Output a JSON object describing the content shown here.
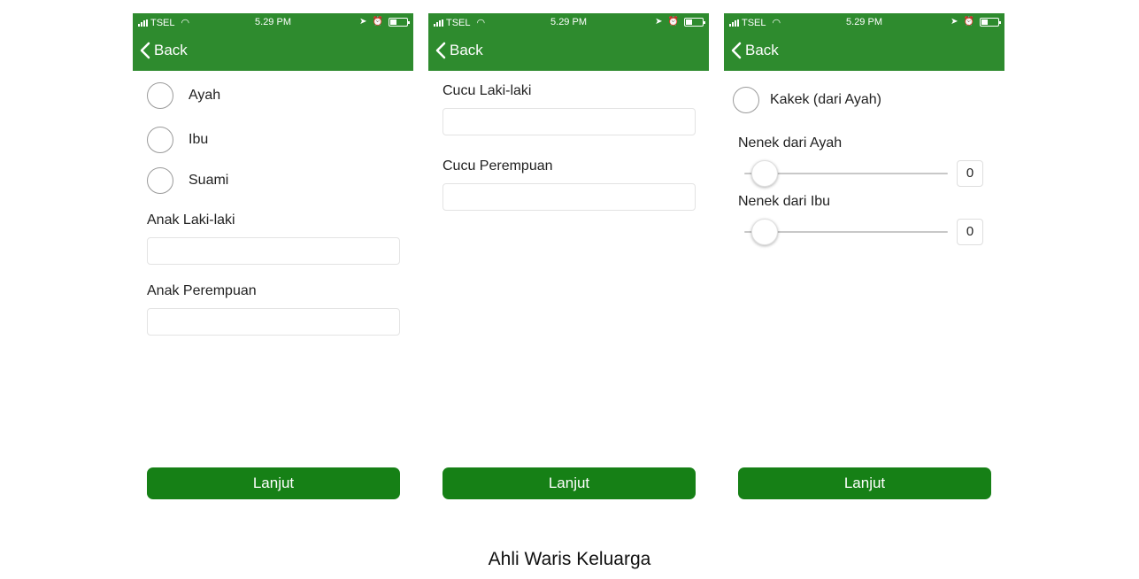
{
  "statusbar": {
    "carrier": "TSEL",
    "time": "5.29 PM",
    "theme_color": "#2e8b2e"
  },
  "navbar": {
    "back_label": "Back"
  },
  "screen1": {
    "radios": [
      {
        "label": "Ayah",
        "selected": false
      },
      {
        "label": "Ibu",
        "selected": false
      },
      {
        "label": "Suami",
        "selected": false
      }
    ],
    "fields": [
      {
        "label": "Anak Laki-laki",
        "value": ""
      },
      {
        "label": "Anak Perempuan",
        "value": ""
      }
    ],
    "button_label": "Lanjut"
  },
  "screen2": {
    "fields": [
      {
        "label": "Cucu Laki-laki",
        "value": ""
      },
      {
        "label": "Cucu Perempuan",
        "value": ""
      }
    ],
    "button_label": "Lanjut"
  },
  "screen3": {
    "radios": [
      {
        "label": "Kakek (dari Ayah)",
        "selected": false
      }
    ],
    "sliders": [
      {
        "label": "Nenek dari Ayah",
        "value": "0"
      },
      {
        "label": "Nenek dari Ibu",
        "value": "0"
      }
    ],
    "button_label": "Lanjut"
  },
  "caption": "Ahli Waris Keluarga",
  "colors": {
    "header": "#2e8b2e",
    "button": "#168016"
  }
}
